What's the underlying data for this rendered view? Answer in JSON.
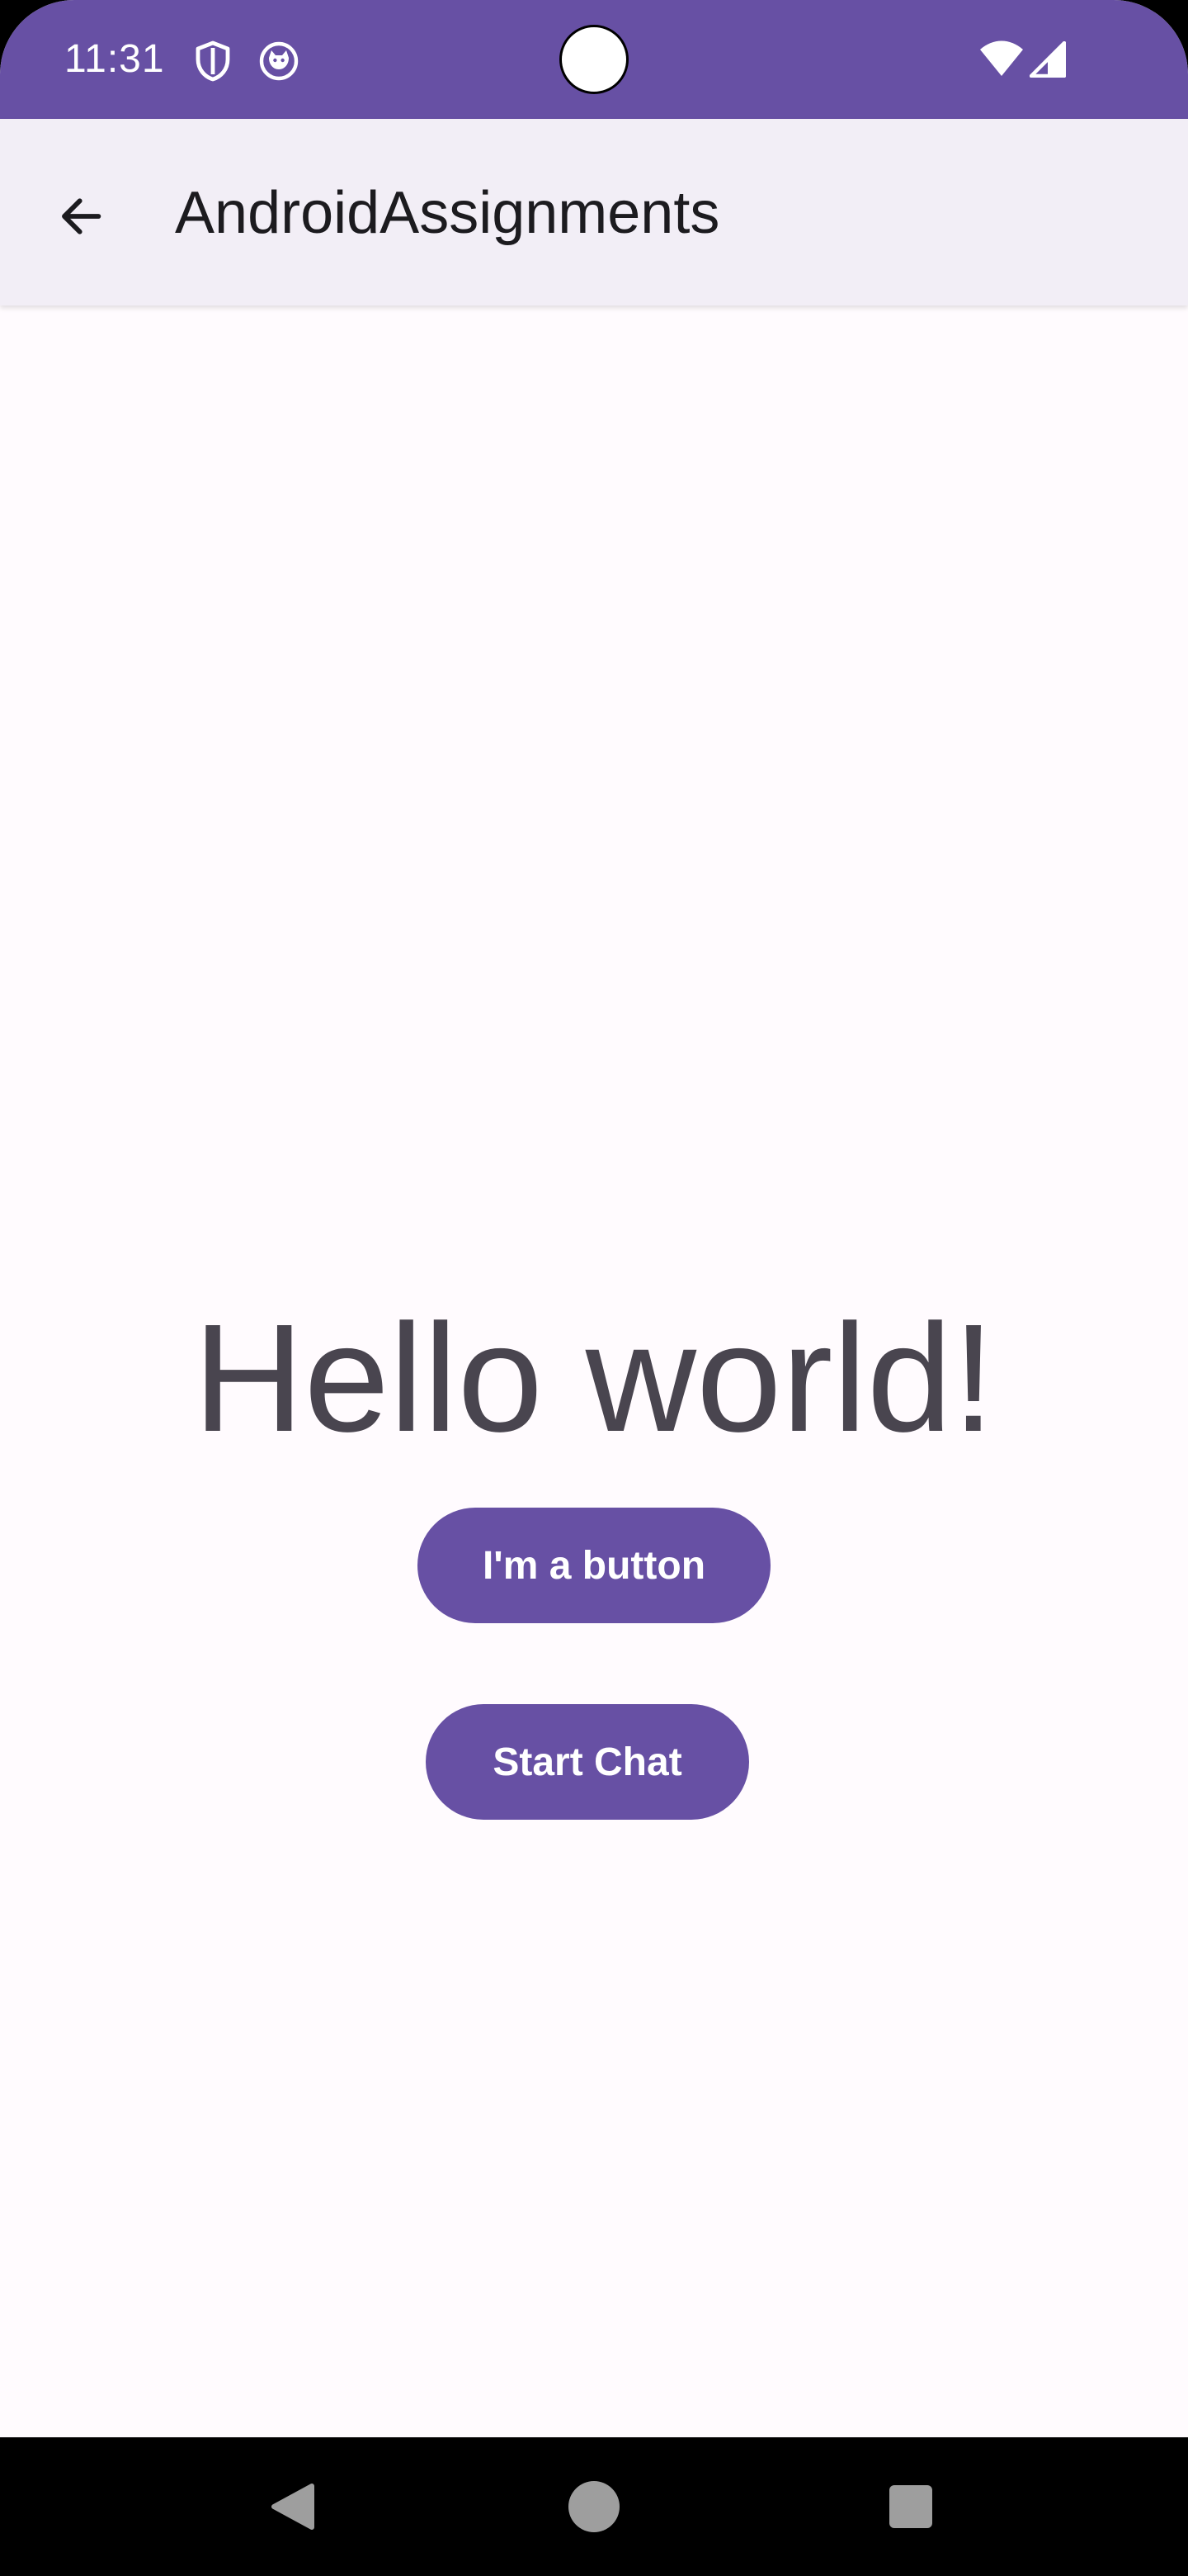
{
  "status_bar": {
    "time": "11:31",
    "icons": [
      "shield-icon",
      "cat-icon",
      "wifi-icon",
      "signal-icon"
    ],
    "background_color": "#6750A4"
  },
  "app_bar": {
    "title": "AndroidAssignments",
    "back_icon": "arrow-back-icon",
    "background_color": "#F2EEF6"
  },
  "main": {
    "greeting": "Hello world!",
    "button_primary_label": "I'm a button",
    "button_chat_label": "Start Chat",
    "accent_color": "#6750A4",
    "text_color": "#49454F"
  },
  "nav_bar": {
    "items": [
      "nav-back-icon",
      "nav-home-icon",
      "nav-recents-icon"
    ]
  }
}
